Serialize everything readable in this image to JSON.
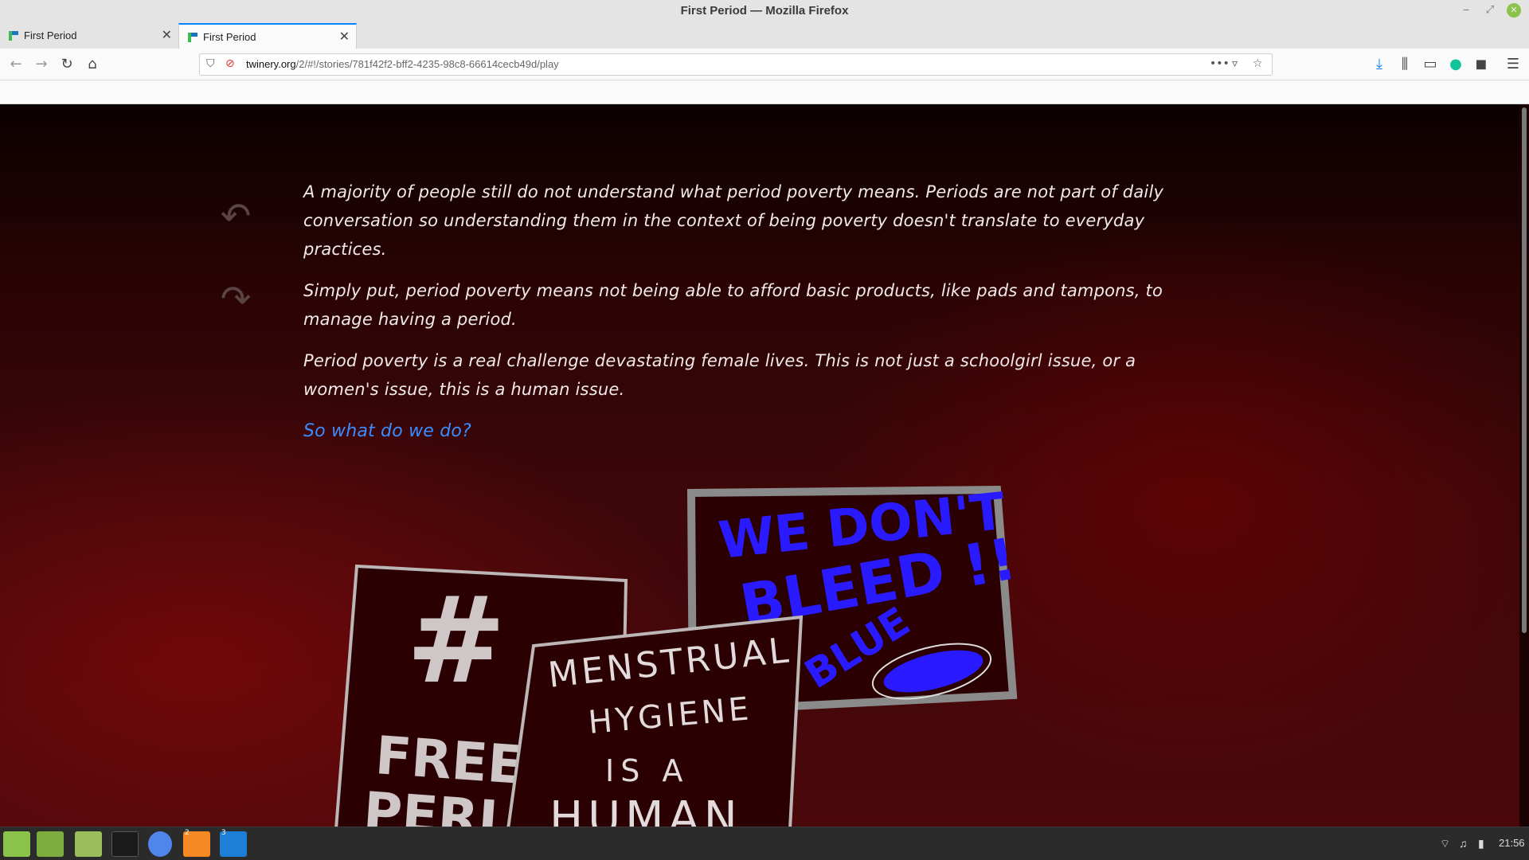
{
  "window": {
    "title": "First Period — Mozilla Firefox"
  },
  "tabs": [
    {
      "label": "First Period",
      "active": false
    },
    {
      "label": "First Period",
      "active": true
    }
  ],
  "urlbar": {
    "host": "twinery.org",
    "path": "/2/#!/stories/781f42f2-bff2-4235-98c8-66614cecb49d/play"
  },
  "passage": {
    "paragraphs": [
      "A majority of people still do not understand what period poverty means. Periods are not part of daily conversation so understanding them in the context of being poverty doesn't translate to everyday practices.",
      "Simply put, period poverty means not being able to afford basic products, like pads and tampons, to manage having a period.",
      "Period poverty is a real challenge devastating female lives. This is not just a schoolgirl issue, or a women's issue, this is a human issue."
    ],
    "link": "So what do we do?"
  },
  "signs": {
    "sign1": "#",
    "sign1_text": "FREE",
    "sign1_text2": "PERI",
    "sign2_line1": "MENSTRUAL",
    "sign2_line2": "HYGIENE",
    "sign2_line3": "IS A",
    "sign2_line4": "HUMAN",
    "sign3_line1": "WE DON'T",
    "sign3_line2": "BLEED !!",
    "sign3_line3": "BLUE"
  },
  "taskbar": {
    "clock": "21:56",
    "badge_firefox": "2",
    "badge_vscode": "3"
  },
  "colors": {
    "accent": "#0a84ff",
    "link": "#3a8cff",
    "sign_blue": "#2a1aff"
  }
}
